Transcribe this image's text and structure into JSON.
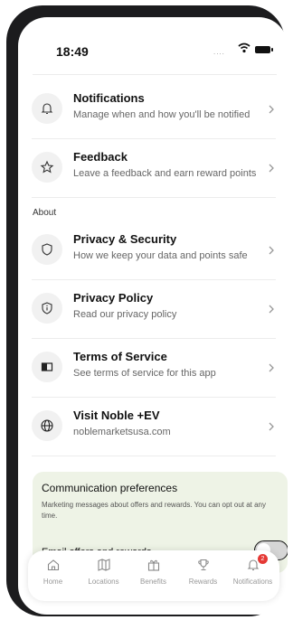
{
  "status_bar": {
    "time": "18:49",
    "dots": "....",
    "icons": [
      "wifi-icon",
      "battery-icon"
    ]
  },
  "settings": {
    "rows": [
      {
        "title": "Notifications",
        "subtitle": "Manage when and how you'll be notified",
        "icon": "bell-icon"
      },
      {
        "title": "Feedback",
        "subtitle": "Leave a feedback and earn reward points",
        "icon": "star-icon"
      }
    ],
    "about_label": "About",
    "about_rows": [
      {
        "title": "Privacy & Security",
        "subtitle": "How we keep your data and points safe",
        "icon": "shield-icon"
      },
      {
        "title": "Privacy Policy",
        "subtitle": "Read our privacy policy",
        "icon": "info-shield-icon"
      },
      {
        "title": "Terms of Service",
        "subtitle": "See terms of service for this app",
        "icon": "book-icon"
      },
      {
        "title": "Visit Noble +EV",
        "subtitle": "noblemarketsusa.com",
        "icon": "globe-icon"
      }
    ]
  },
  "communication": {
    "title": "Communication preferences",
    "description": "Marketing messages about offers and rewards. You can opt out at any time.",
    "email_label": "Email offers and rewards",
    "email_enabled": false
  },
  "tabbar": {
    "tabs": [
      {
        "label": "Home",
        "icon": "home-icon"
      },
      {
        "label": "Locations",
        "icon": "map-icon"
      },
      {
        "label": "Benefits",
        "icon": "gift-icon"
      },
      {
        "label": "Rewards",
        "icon": "trophy-icon"
      },
      {
        "label": "Notifications",
        "icon": "bell-icon",
        "badge": "2"
      }
    ]
  },
  "colors": {
    "card_bg": "#eef3e6",
    "badge": "#e53935",
    "divider": "#ececec"
  }
}
